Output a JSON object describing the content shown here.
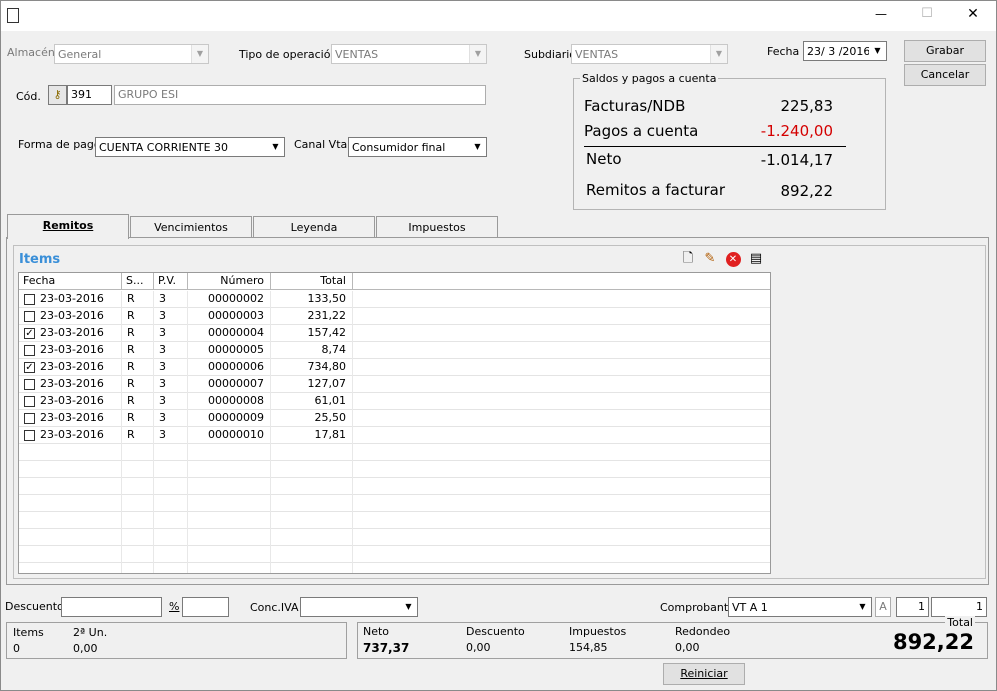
{
  "titlebar": {
    "minimize": "—",
    "maximize": "☐",
    "close": "✕"
  },
  "header": {
    "almacen_label": "Almacén",
    "almacen_value": "General",
    "tipo_label": "Tipo de operación",
    "tipo_value": "VENTAS",
    "subdiario_label": "Subdiario",
    "subdiario_value": "VENTAS",
    "fecha_label": "Fecha",
    "fecha_value": "23/ 3 /2016",
    "grabar": "Grabar",
    "cancelar": "Cancelar",
    "cod_label": "Cód.",
    "cod_value": "391",
    "cod_name": "GRUPO ESI",
    "forma_label": "Forma de pago",
    "forma_value": "CUENTA CORRIENTE 30",
    "canal_label": "Canal Vta.",
    "canal_value": "Consumidor final"
  },
  "saldos": {
    "title": "Saldos y pagos a cuenta",
    "facturas_label": "Facturas/NDB",
    "facturas_value": "225,83",
    "pagos_label": "Pagos a cuenta",
    "pagos_value": "-1.240,00",
    "neto_label": "Neto",
    "neto_value": "-1.014,17",
    "remitos_label": "Remitos a facturar",
    "remitos_value": "892,22",
    "negative_color": "#d40000"
  },
  "tabs": [
    {
      "label": "Remitos"
    },
    {
      "label": "Vencimientos"
    },
    {
      "label": "Leyenda"
    },
    {
      "label": "Impuestos"
    }
  ],
  "items": {
    "title": "Items",
    "title_color": "#3a8fd8",
    "toolbar_icons": [
      "new-document-icon",
      "edit-icon",
      "delete-icon",
      "properties-icon"
    ],
    "columns": [
      "Fecha",
      "S...",
      "P.V.",
      "Número",
      "Total"
    ],
    "rows": [
      {
        "checked": false,
        "fecha": "23-03-2016",
        "s": "R",
        "pv": "3",
        "numero": "00000002",
        "total": "133,50"
      },
      {
        "checked": false,
        "fecha": "23-03-2016",
        "s": "R",
        "pv": "3",
        "numero": "00000003",
        "total": "231,22"
      },
      {
        "checked": true,
        "fecha": "23-03-2016",
        "s": "R",
        "pv": "3",
        "numero": "00000004",
        "total": "157,42"
      },
      {
        "checked": false,
        "fecha": "23-03-2016",
        "s": "R",
        "pv": "3",
        "numero": "00000005",
        "total": "8,74"
      },
      {
        "checked": true,
        "fecha": "23-03-2016",
        "s": "R",
        "pv": "3",
        "numero": "00000006",
        "total": "734,80"
      },
      {
        "checked": false,
        "fecha": "23-03-2016",
        "s": "R",
        "pv": "3",
        "numero": "00000007",
        "total": "127,07"
      },
      {
        "checked": false,
        "fecha": "23-03-2016",
        "s": "R",
        "pv": "3",
        "numero": "00000008",
        "total": "61,01"
      },
      {
        "checked": false,
        "fecha": "23-03-2016",
        "s": "R",
        "pv": "3",
        "numero": "00000009",
        "total": "25,50"
      },
      {
        "checked": false,
        "fecha": "23-03-2016",
        "s": "R",
        "pv": "3",
        "numero": "00000010",
        "total": "17,81"
      }
    ]
  },
  "footer": {
    "descuento_label": "Descuento",
    "pct_label": "%",
    "conc_label": "Conc.IVA",
    "comprobante_label": "Comprobante",
    "comprobante_value": "VT A 1",
    "letra": "A",
    "num1": "1",
    "num2": "1",
    "items_label": "Items",
    "items_value": "0",
    "segunda_label": "2ª Un.",
    "segunda_value": "0,00",
    "neto_label": "Neto",
    "neto_value": "737,37",
    "descuento2_label": "Descuento",
    "descuento2_value": "0,00",
    "impuestos_label": "Impuestos",
    "impuestos_value": "154,85",
    "redondeo_label": "Redondeo",
    "redondeo_value": "0,00",
    "total_label": "Total",
    "total_value": "892,22",
    "reiniciar": "Reiniciar"
  }
}
